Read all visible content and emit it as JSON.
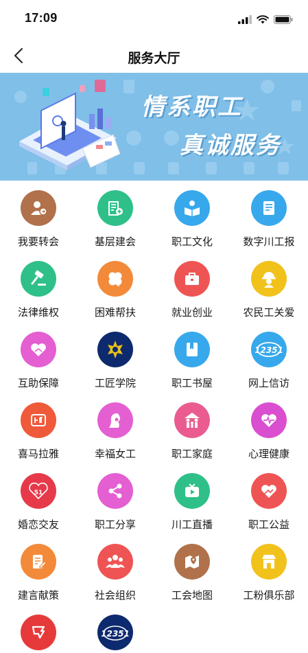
{
  "status": {
    "time": "17:09"
  },
  "nav": {
    "title": "服务大厅"
  },
  "banner": {
    "line1": "情系职工",
    "line2": "真诚服务"
  },
  "services": [
    {
      "label": "我要转会",
      "icon": "user-transfer-icon",
      "color": "#b0714b"
    },
    {
      "label": "基层建会",
      "icon": "building-plus-icon",
      "color": "#2fc08a"
    },
    {
      "label": "职工文化",
      "icon": "reader-icon",
      "color": "#37a8ec"
    },
    {
      "label": "数字川工报",
      "icon": "document-icon",
      "color": "#37a8ec"
    },
    {
      "label": "法律维权",
      "icon": "gavel-icon",
      "color": "#2fc08a"
    },
    {
      "label": "困难帮扶",
      "icon": "clover-icon",
      "color": "#f28a3a"
    },
    {
      "label": "就业创业",
      "icon": "briefcase-icon",
      "color": "#ef5454"
    },
    {
      "label": "农民工关爱",
      "icon": "worker-helmet-icon",
      "color": "#f2c21c"
    },
    {
      "label": "互助保障",
      "icon": "heart-hands-icon",
      "color": "#e45fd2"
    },
    {
      "label": "工匠学院",
      "icon": "craftsman-emblem-icon",
      "color": "#0e2a6e"
    },
    {
      "label": "职工书屋",
      "icon": "bookmark-book-icon",
      "color": "#37a8ec"
    },
    {
      "label": "网上信访",
      "icon": "hotline-12351-icon",
      "color": "#37a8ec"
    },
    {
      "label": "喜马拉雅",
      "icon": "ting-icon",
      "color": "#ef5a3a"
    },
    {
      "label": "幸福女工",
      "icon": "woman-profile-icon",
      "color": "#e45fd2"
    },
    {
      "label": "职工家庭",
      "icon": "family-icon",
      "color": "#ea5c8f"
    },
    {
      "label": "心理健康",
      "icon": "heartbeat-icon",
      "color": "#d94fd0"
    },
    {
      "label": "婚恋交友",
      "icon": "51-love-icon",
      "color": "#e63a4a"
    },
    {
      "label": "职工分享",
      "icon": "share-icon",
      "color": "#e45fd2"
    },
    {
      "label": "川工直播",
      "icon": "live-video-icon",
      "color": "#2fc08a"
    },
    {
      "label": "职工公益",
      "icon": "charity-heart-icon",
      "color": "#ef5454"
    },
    {
      "label": "建言献策",
      "icon": "edit-note-icon",
      "color": "#f28a3a"
    },
    {
      "label": "社会组织",
      "icon": "group-icon",
      "color": "#ef5454"
    },
    {
      "label": "工会地图",
      "icon": "map-pin-icon",
      "color": "#b0714b"
    },
    {
      "label": "工粉俱乐部",
      "icon": "storefront-icon",
      "color": "#f2c21c"
    },
    {
      "label": "",
      "icon": "emblem-icon",
      "color": "#e63a3a"
    },
    {
      "label": "",
      "icon": "hotline-12351-badge-icon",
      "color": "#0e2a6e"
    }
  ]
}
